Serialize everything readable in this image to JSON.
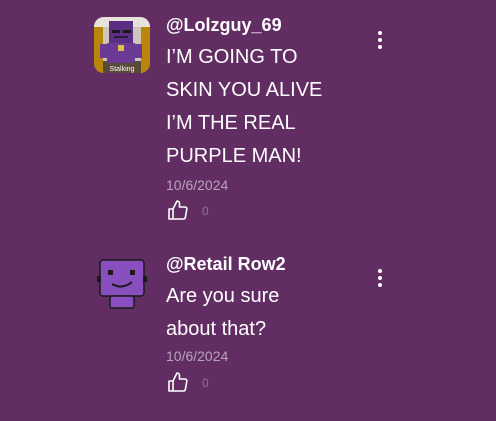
{
  "colors": {
    "background": "#612d63",
    "text": "#ffffff",
    "muted": "#b9a4bb"
  },
  "comments": [
    {
      "username": "@Lolzguy_69",
      "avatar_caption": "Stalking",
      "body_lines": [
        "I’M GOING TO",
        "SKIN YOU ALIVE",
        "I’M THE REAL",
        "PURPLE MAN!"
      ],
      "date": "10/6/2024",
      "likes": "0",
      "like_icon": "thumbs-up-icon",
      "more_icon": "more-vertical-icon"
    },
    {
      "username": "@Retail Row2",
      "body_lines": [
        "Are you sure",
        "about that?"
      ],
      "date": "10/6/2024",
      "likes": "0",
      "like_icon": "thumbs-up-icon",
      "more_icon": "more-vertical-icon"
    }
  ]
}
